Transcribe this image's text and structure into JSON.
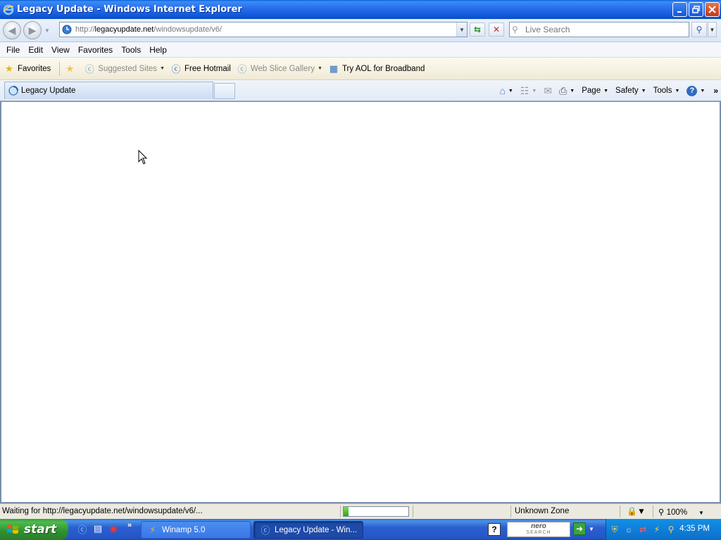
{
  "window": {
    "title": "Legacy Update - Windows Internet Explorer",
    "buttons": [
      "minimize",
      "restore",
      "close"
    ]
  },
  "address_bar": {
    "url_scheme": "http://",
    "url_domain": "legacyupdate.net",
    "url_path": "/windowsupdate/v6/",
    "search_placeholder": "Live Search"
  },
  "menu": {
    "items": [
      "File",
      "Edit",
      "View",
      "Favorites",
      "Tools",
      "Help"
    ]
  },
  "favorites_bar": {
    "favorites_label": "Favorites",
    "items": [
      {
        "label": "Suggested Sites",
        "dim": true
      },
      {
        "label": "Free Hotmail",
        "dim": false
      },
      {
        "label": "Web Slice Gallery",
        "dim": true
      },
      {
        "label": "Try AOL for Broadband",
        "dim": false
      }
    ]
  },
  "tabs": {
    "active_tab": "Legacy Update"
  },
  "command_bar": {
    "page": "Page",
    "safety": "Safety",
    "tools": "Tools"
  },
  "status_bar": {
    "text": "Waiting for http://legacyupdate.net/windowsupdate/v6/...",
    "progress": 0.08,
    "zone": "Unknown Zone",
    "zoom": "100%"
  },
  "taskbar": {
    "start_label": "start",
    "buttons": [
      {
        "label": "Winamp 5.0",
        "active": false
      },
      {
        "label": "Legacy Update - Win...",
        "active": true
      }
    ],
    "nero_top": "nero",
    "nero_bottom": "SEARCH",
    "clock": "4:35 PM"
  },
  "colors": {
    "titlebar": "#0d55d6",
    "taskbar": "#2456c8",
    "start_button": "#2f8f2f",
    "tray": "#0f7fd9"
  }
}
